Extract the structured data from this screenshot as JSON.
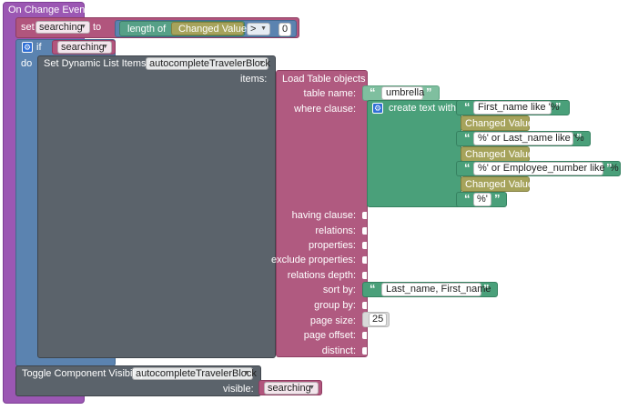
{
  "event": {
    "title": "On Change Event"
  },
  "set_block": {
    "label_set": "set",
    "variable": "searching",
    "label_to": "to",
    "length_label": "length of",
    "changed_value": "Changed Value",
    "operator": ">",
    "number": "0"
  },
  "if_block": {
    "label_if": "if",
    "condition_variable": "searching",
    "label_do": "do"
  },
  "dyn_list": {
    "label": "Set Dynamic List Items to",
    "component": "autocompleteTravelerBlock",
    "items_label": "items:"
  },
  "load_table": {
    "title": "Load Table objects",
    "params": [
      "table name:",
      "where clause:",
      "having clause:",
      "relations:",
      "properties:",
      "exclude properties:",
      "relations depth:",
      "sort by:",
      "group by:",
      "page size:",
      "page offset:",
      "distinct:"
    ],
    "table_name": "umbrella",
    "create_text_label": "create text with",
    "where_parts": [
      "First_name like '%",
      "Changed Value",
      "%' or Last_name like '%",
      "Changed Value",
      "%' or Employee_number like '%",
      "Changed Value",
      "%'"
    ],
    "sort_by": "Last_name, First_name",
    "page_size": "25"
  },
  "toggle": {
    "label": "Toggle Component Visibility",
    "component": "autocompleteTravelerBlock",
    "visible_label": "visible:",
    "visible_variable": "searching"
  },
  "colors": {
    "event": "#9b57b3",
    "set": "#b1557d",
    "if": "#5b83b0",
    "dynamic": "#5b636b",
    "load": "#b05a80",
    "text": "#4aa07a",
    "changed_value": "#a6a35b"
  }
}
